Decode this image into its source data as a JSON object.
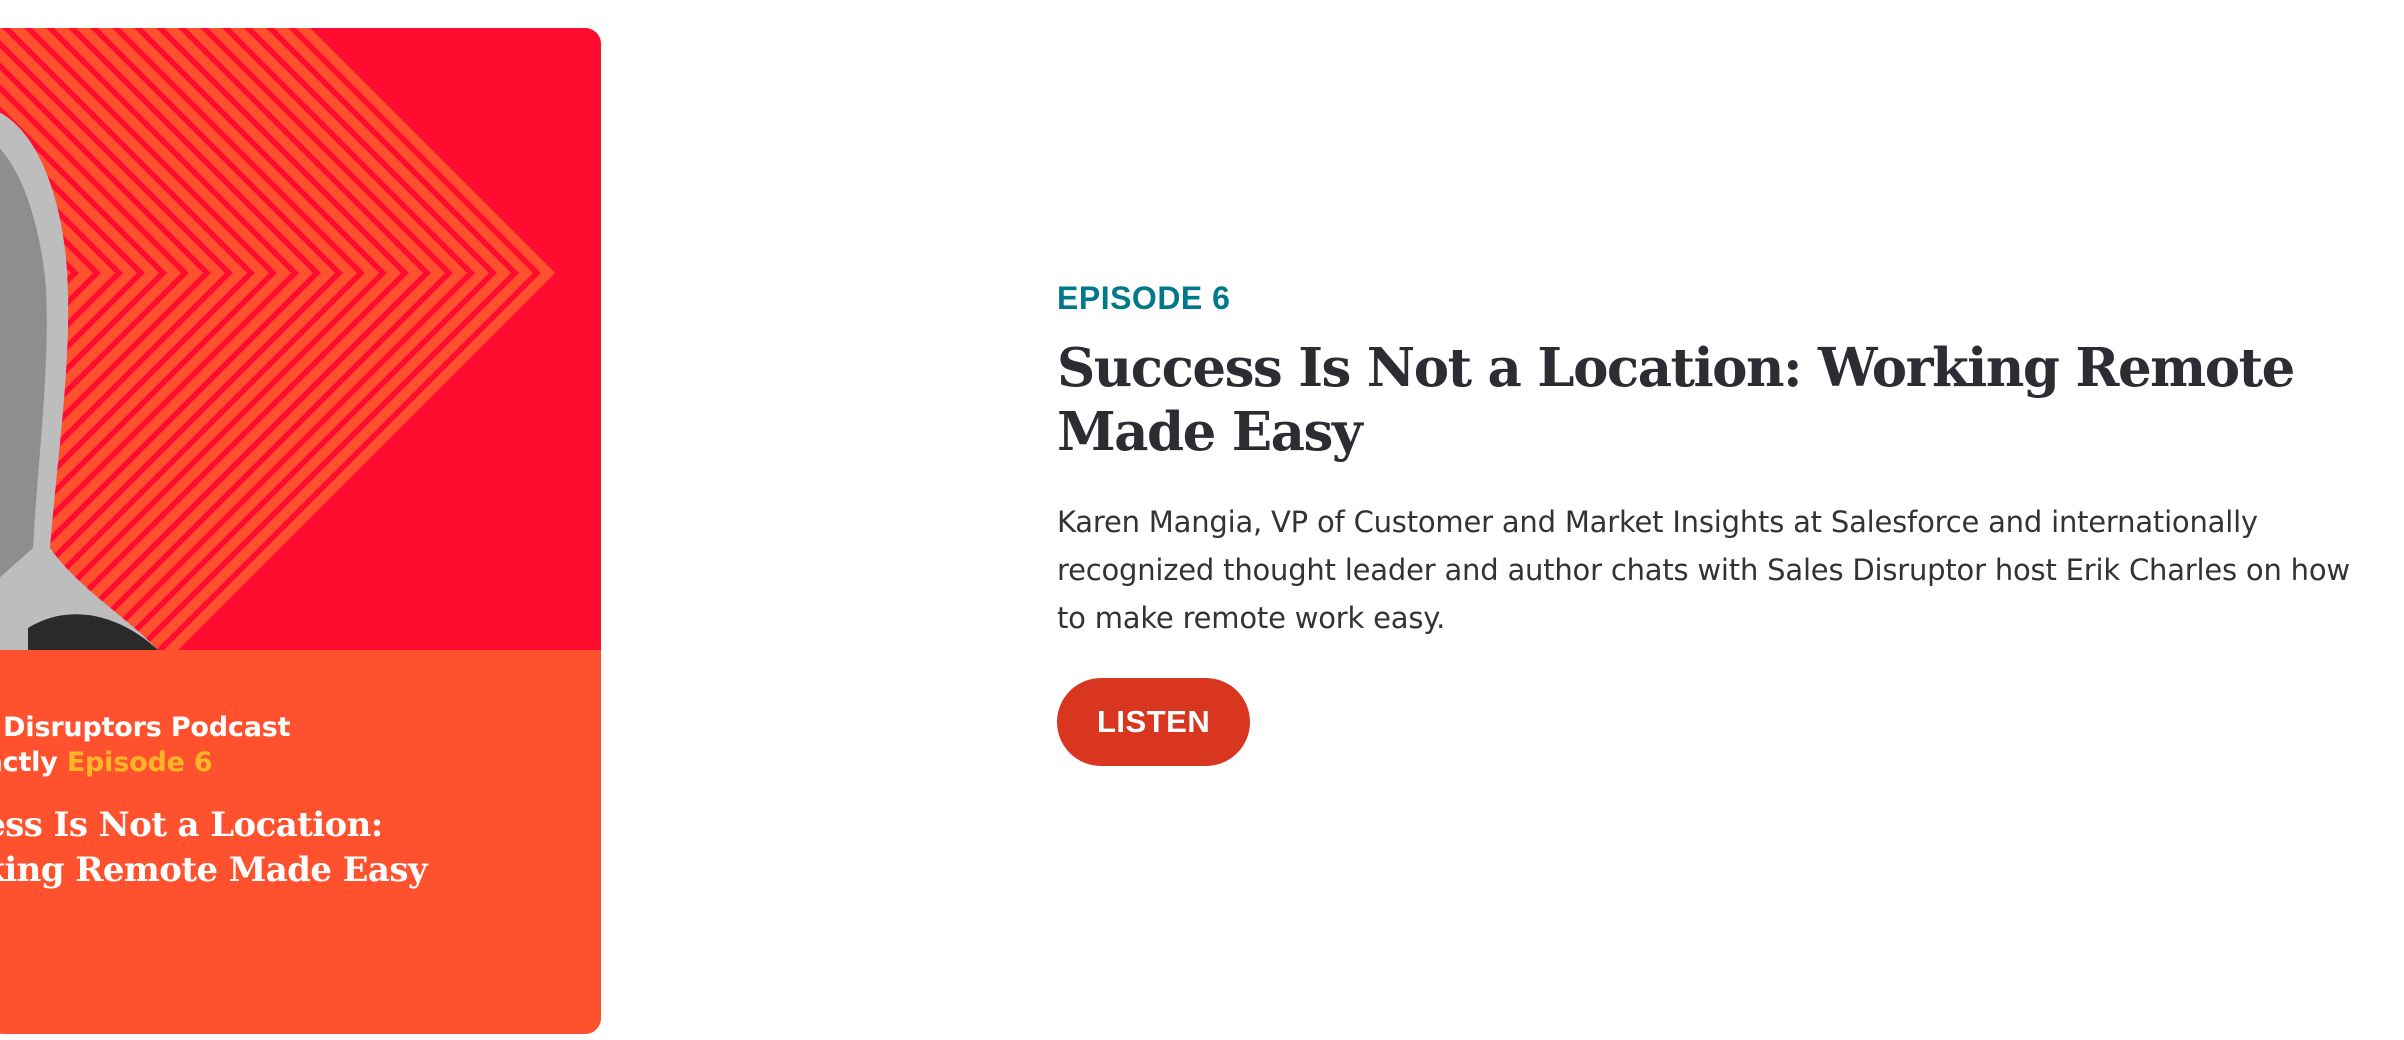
{
  "episode": {
    "label": "EPISODE 6",
    "title": "Success Is Not a Location: Working Remote Made Easy",
    "description": "Karen Mangia, VP of Customer and Market Insights at Salesforce and internationally recognized thought leader and author chats with Sales Disruptor host Erik Charles on how to make remote work easy.",
    "listen_label": "LISTEN"
  },
  "artwork": {
    "line1": "es Disruptors Podcast",
    "line2_prefix": "Xactly",
    "line2_episode": "Episode 6",
    "title_line1": "ccess Is Not a Location:",
    "title_line2": "orking Remote Made Easy"
  },
  "colors": {
    "accent_teal": "#02788b",
    "button_red": "#d8361e",
    "artwork_red": "#ff0c30",
    "artwork_orange": "#ff512d",
    "artwork_yellow": "#ffb626"
  }
}
